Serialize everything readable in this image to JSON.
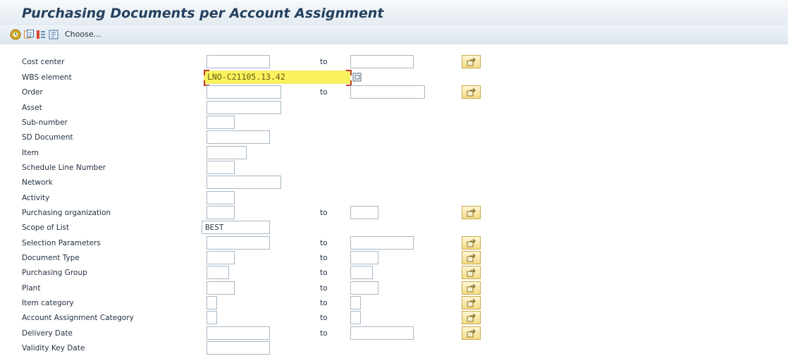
{
  "title": "Purchasing Documents per Account Assignment",
  "toolbar": {
    "execute_icon": "execute-clock-icon",
    "variants_icon": "get-variant-icon",
    "save_icon": "save-variant-icon",
    "dynamic_icon": "dynamic-selections-icon",
    "choose_label": "Choose..."
  },
  "fields": {
    "cost_center": {
      "label": "Cost center",
      "to_label": "to"
    },
    "wbs_element": {
      "label": "WBS element",
      "value": "LNO-C21105.13.42"
    },
    "order": {
      "label": "Order",
      "to_label": "to"
    },
    "asset": {
      "label": "Asset"
    },
    "sub_number": {
      "label": "Sub-number"
    },
    "sd_document": {
      "label": "SD Document"
    },
    "item": {
      "label": "Item"
    },
    "schedule_line": {
      "label": "Schedule Line Number"
    },
    "network": {
      "label": "Network"
    },
    "activity": {
      "label": "Activity"
    },
    "purch_org": {
      "label": "Purchasing organization",
      "to_label": "to"
    },
    "scope_of_list": {
      "label": "Scope of List",
      "value": "BEST"
    },
    "selection_params": {
      "label": "Selection Parameters",
      "to_label": "to"
    },
    "document_type": {
      "label": "Document Type",
      "to_label": "to"
    },
    "purchasing_group": {
      "label": "Purchasing Group",
      "to_label": "to"
    },
    "plant": {
      "label": "Plant",
      "to_label": "to"
    },
    "item_category": {
      "label": "Item category",
      "to_label": "to"
    },
    "acct_assign_cat": {
      "label": "Account Assignment Category",
      "to_label": "to"
    },
    "delivery_date": {
      "label": "Delivery Date",
      "to_label": "to"
    },
    "validity_key_date": {
      "label": "Validity Key Date"
    }
  },
  "colors": {
    "title_text": "#24415f",
    "highlight": "#f9f25e",
    "multi_button": "#f4dc86"
  }
}
